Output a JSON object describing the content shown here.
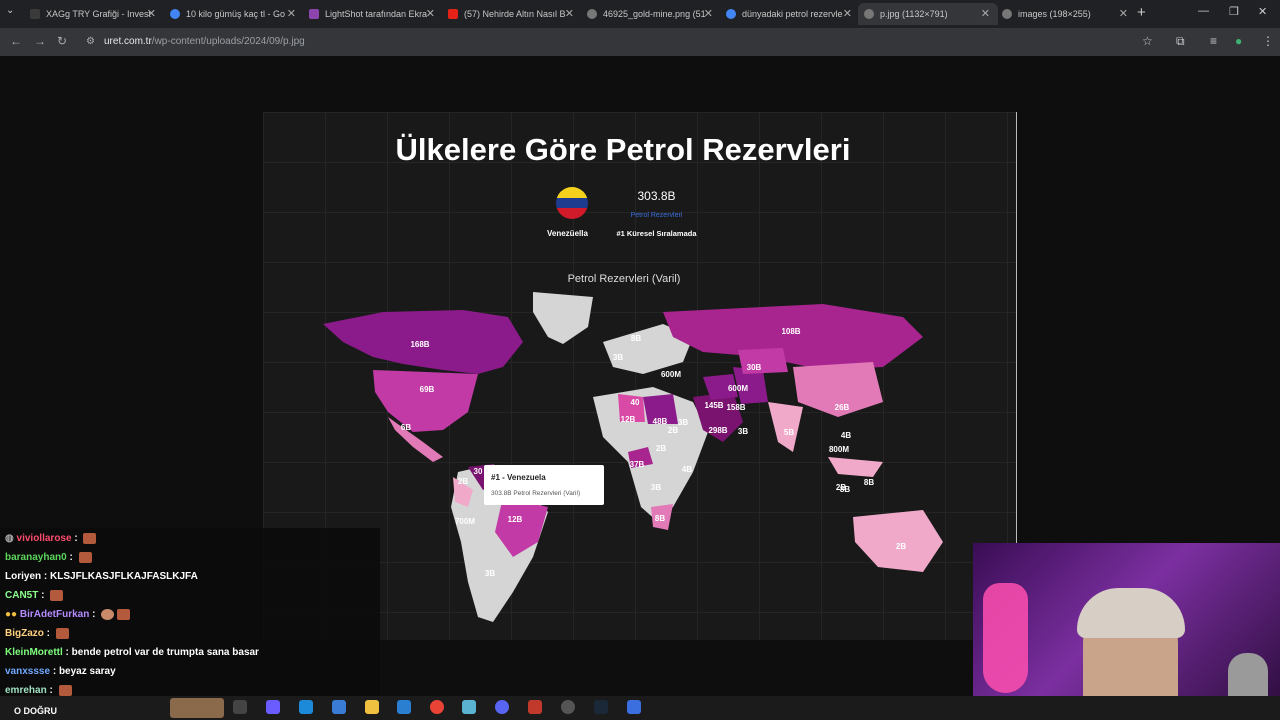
{
  "browser": {
    "tabs": [
      {
        "label": "XAGg TRY Grafiği - Invest",
        "color": "#3a3a3a"
      },
      {
        "label": "10 kilo gümüş kaç tl - Go",
        "color": "#4285f4"
      },
      {
        "label": "LightShot tarafından Ekra",
        "color": "#8e44ad"
      },
      {
        "label": "(57) Nehirde Altın Nasıl B",
        "color": "#e62117"
      },
      {
        "label": "46925_gold-mine.png (51",
        "color": "#777777"
      },
      {
        "label": "dünyadaki petrol rezervle",
        "color": "#4285f4"
      },
      {
        "label": "p.jpg (1132×791)",
        "color": "#777777"
      },
      {
        "label": "images (198×255)",
        "color": "#777777"
      }
    ],
    "url_host": "uret.com.tr",
    "url_path": "/wp-content/uploads/2024/09/p.jpg"
  },
  "infographic": {
    "title": "Ülkelere Göre Petrol Rezervleri",
    "country": "Venezüella",
    "reserve": "303.8B",
    "reserve_label": "Petrol Rezervleri",
    "rank": "#1 Küresel Sıralamada",
    "map_title": "Petrol Rezervleri (Varil)",
    "tooltip_title": "#1 - Venezuela",
    "tooltip_sub": "303.8B Petrol Rezervleri (Varil)",
    "flag_colors": [
      "#f4d11d",
      "#1e3c8f",
      "#d11a2a"
    ],
    "map_labels": [
      "168B",
      "69B",
      "6B",
      "2B",
      "700M",
      "12B",
      "3B",
      "30",
      "8B",
      "3B",
      "600M",
      "40",
      "12B",
      "48B",
      "3B",
      "2B",
      "4B",
      "3B",
      "8B",
      "37B",
      "2B",
      "145B",
      "158B",
      "298B",
      "3B",
      "600M",
      "30B",
      "108B",
      "26B",
      "5B",
      "4B",
      "800M",
      "2B",
      "8B",
      "2B",
      "8B"
    ]
  },
  "chat": {
    "messages": [
      {
        "user": "viviollarose",
        "text": "",
        "color": "#ff4b6e"
      },
      {
        "user": "baranayhan0",
        "text": "",
        "color": "#5cd65c"
      },
      {
        "user": "Loriyen",
        "text": "KLSJFLKASJFLKAJFASLKJFA",
        "color": "#ffffff"
      },
      {
        "user": "CAN5T",
        "text": "",
        "color": "#8cff8c"
      },
      {
        "user": "BirAdetFurkan",
        "text": "",
        "color": "#b58cff"
      },
      {
        "user": "BigZazo",
        "text": "",
        "color": "#ffd27f"
      },
      {
        "user": "KleinMorettl",
        "text": "bende petrol var de trumpta sana basar",
        "color": "#7fff7f"
      },
      {
        "user": "vanxssse",
        "text": "beyaz saray",
        "color": "#6fa8ff"
      },
      {
        "user": "emrehan",
        "text": "",
        "color": "#9fe0c0"
      }
    ]
  },
  "taskbar": {
    "label": "O DOĞRU"
  }
}
